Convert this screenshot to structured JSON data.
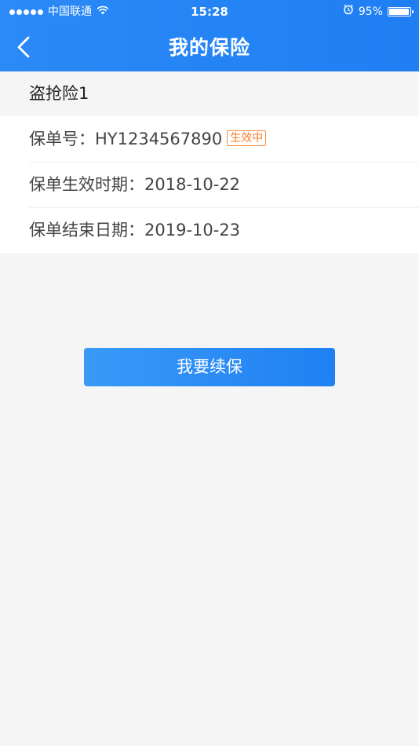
{
  "status_bar": {
    "carrier": "中国联通",
    "time": "15:28",
    "battery_percent": "95%",
    "battery_level": 0.95
  },
  "nav": {
    "title": "我的保险"
  },
  "policy": {
    "name": "盗抢险1",
    "number_label": "保单号：",
    "number_value": "HY1234567890",
    "status_badge": "生效中",
    "start_label": "保单生效时期：",
    "start_value": "2018-10-22",
    "end_label": "保单结束日期：",
    "end_value": "2019-10-23"
  },
  "actions": {
    "renew_label": "我要续保"
  },
  "colors": {
    "primary": "#1f7ef3",
    "badge": "#ff7b28",
    "background": "#f5f5f5"
  },
  "icons": {
    "back": "chevron-left-icon",
    "wifi": "wifi-icon",
    "alarm": "alarm-icon",
    "battery": "battery-icon"
  }
}
